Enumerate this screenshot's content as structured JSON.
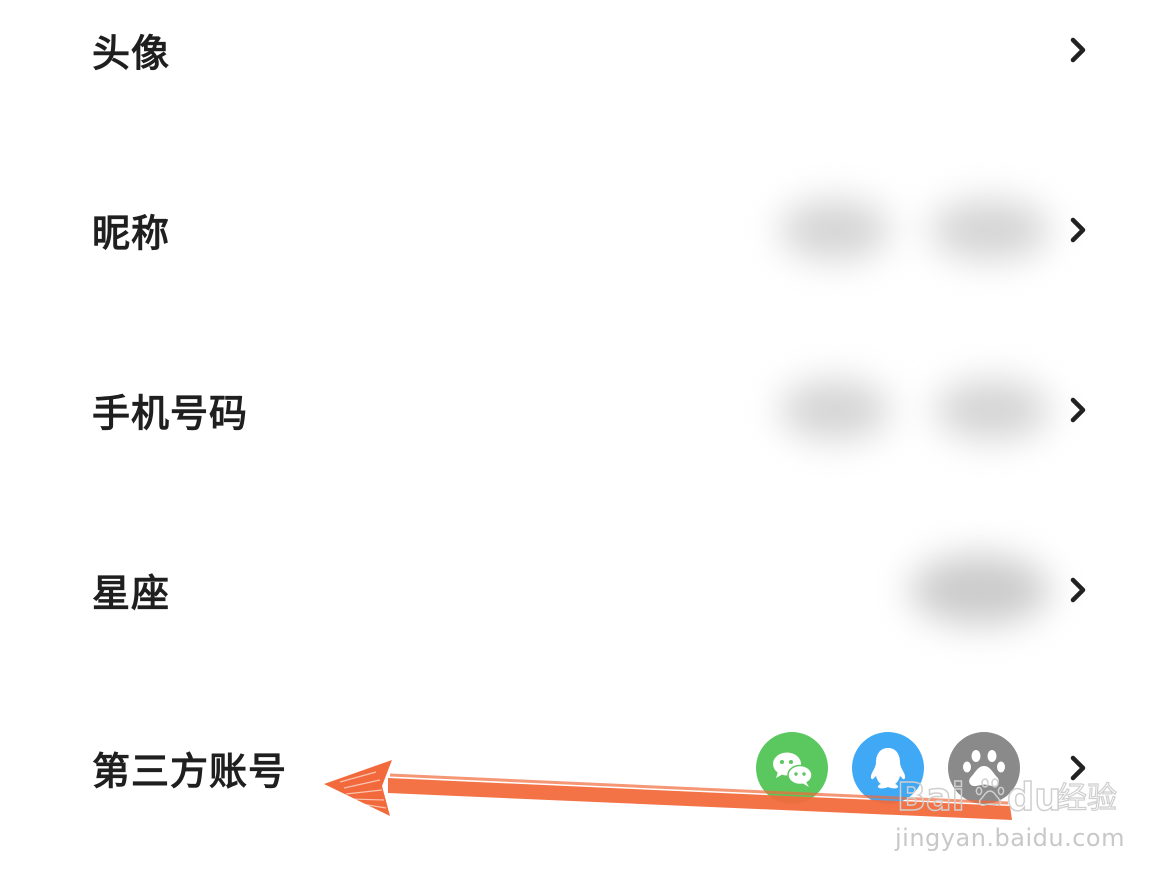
{
  "settings": {
    "rows": [
      {
        "label": "头像"
      },
      {
        "label": "昵称"
      },
      {
        "label": "手机号码"
      },
      {
        "label": "星座"
      },
      {
        "label": "第三方账号"
      }
    ],
    "third_party_icons": [
      "wechat-icon",
      "qq-icon",
      "baidu-icon"
    ]
  },
  "colors": {
    "text": "#1f1f1f",
    "chevron": "#222222",
    "wechat": "#5bc75f",
    "qq": "#3fa9f5",
    "baidu": "#8a8a8a",
    "arrow": "#f26a3c"
  },
  "watermark": {
    "brand": "Bai du 经验",
    "domain": "jingyan.baidu.com"
  }
}
